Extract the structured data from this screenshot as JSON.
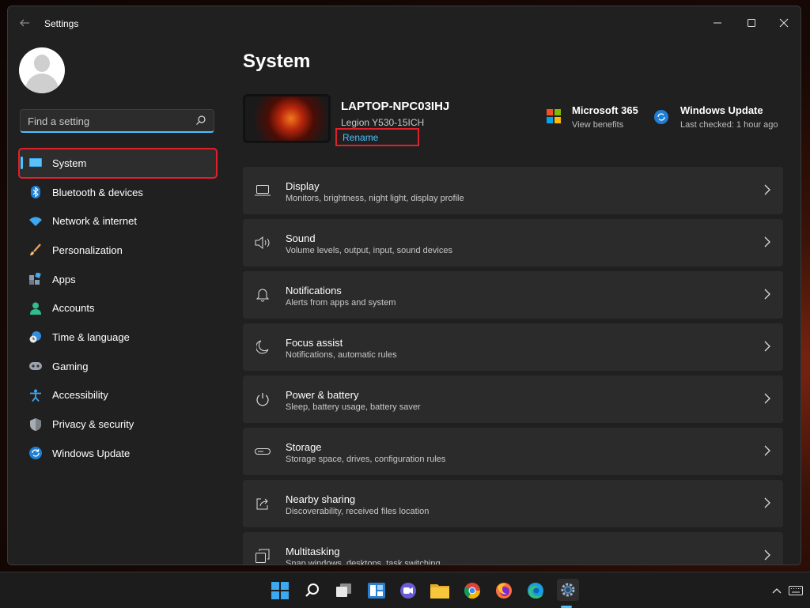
{
  "window": {
    "title": "Settings"
  },
  "sidebar": {
    "search_placeholder": "Find a setting",
    "items": [
      {
        "label": "System",
        "icon": "system-display-icon",
        "active": true
      },
      {
        "label": "Bluetooth & devices",
        "icon": "bluetooth-icon"
      },
      {
        "label": "Network & internet",
        "icon": "wifi-icon"
      },
      {
        "label": "Personalization",
        "icon": "brush-icon"
      },
      {
        "label": "Apps",
        "icon": "apps-icon"
      },
      {
        "label": "Accounts",
        "icon": "person-icon"
      },
      {
        "label": "Time & language",
        "icon": "globe-clock-icon"
      },
      {
        "label": "Gaming",
        "icon": "gamepad-icon"
      },
      {
        "label": "Accessibility",
        "icon": "accessibility-icon"
      },
      {
        "label": "Privacy & security",
        "icon": "shield-icon"
      },
      {
        "label": "Windows Update",
        "icon": "sync-icon"
      }
    ]
  },
  "main": {
    "title": "System",
    "device": {
      "name": "LAPTOP-NPC03IHJ",
      "model": "Legion Y530-15ICH",
      "rename_label": "Rename"
    },
    "promos": [
      {
        "title": "Microsoft 365",
        "subtitle": "View benefits",
        "icon": "microsoft-logo-icon"
      },
      {
        "title": "Windows Update",
        "subtitle": "Last checked: 1 hour ago",
        "icon": "windows-update-icon"
      }
    ],
    "cards": [
      {
        "title": "Display",
        "subtitle": "Monitors, brightness, night light, display profile",
        "icon": "display-icon"
      },
      {
        "title": "Sound",
        "subtitle": "Volume levels, output, input, sound devices",
        "icon": "speaker-icon"
      },
      {
        "title": "Notifications",
        "subtitle": "Alerts from apps and system",
        "icon": "bell-icon"
      },
      {
        "title": "Focus assist",
        "subtitle": "Notifications, automatic rules",
        "icon": "moon-icon"
      },
      {
        "title": "Power & battery",
        "subtitle": "Sleep, battery usage, battery saver",
        "icon": "power-icon"
      },
      {
        "title": "Storage",
        "subtitle": "Storage space, drives, configuration rules",
        "icon": "storage-icon"
      },
      {
        "title": "Nearby sharing",
        "subtitle": "Discoverability, received files location",
        "icon": "share-icon"
      },
      {
        "title": "Multitasking",
        "subtitle": "Snap windows, desktops, task switching",
        "icon": "multitasking-icon"
      }
    ]
  },
  "taskbar": {
    "apps": [
      "start-icon",
      "search-icon",
      "task-view-icon",
      "widgets-icon",
      "chat-icon",
      "file-explorer-icon",
      "chrome-icon",
      "firefox-icon",
      "edge-icon",
      "settings-icon"
    ],
    "tray_icon": "chevron-up-icon"
  },
  "colors": {
    "accent": "#4cc2ff",
    "highlight_red": "#e0202a",
    "card_bg": "#2b2b2b",
    "window_bg": "#202020"
  }
}
